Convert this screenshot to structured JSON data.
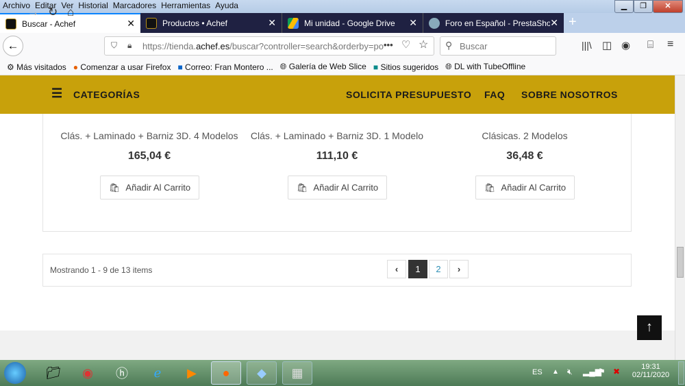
{
  "menu": [
    "Archivo",
    "Editar",
    "Ver",
    "Historial",
    "Marcadores",
    "Herramientas",
    "Ayuda"
  ],
  "tabs": [
    {
      "label": "Buscar - Achef"
    },
    {
      "label": "Productos • Achef"
    },
    {
      "label": "Mi unidad - Google Drive"
    },
    {
      "label": "Foro en Español - PrestaShop F"
    }
  ],
  "url": {
    "pre": "https://tienda.",
    "host": "achef.es",
    "post": "/buscar?controller=search&orderby=po"
  },
  "search_placeholder": "Buscar",
  "bookmarks": [
    "Más visitados",
    "Comenzar a usar Firefox",
    "Correo: Fran Montero ...",
    "Galería de Web Slice",
    "Sitios sugeridos",
    "DL with TubeOffline"
  ],
  "header": {
    "categories": "CATEGORÍAS",
    "nav": [
      "SOLICITA PRESUPUESTO",
      "FAQ",
      "SOBRE NOSOTROS"
    ]
  },
  "products": [
    {
      "name": "Clás. + Laminado + Barniz 3D. 4 Modelos",
      "price": "165,04 €",
      "cart": "Añadir Al Carrito"
    },
    {
      "name": "Clás. + Laminado + Barniz 3D. 1 Modelo",
      "price": "111,10 €",
      "cart": "Añadir Al Carrito"
    },
    {
      "name": "Clásicas. 2 Modelos",
      "price": "36,48 €",
      "cart": "Añadir Al Carrito"
    }
  ],
  "pagination": {
    "summary": "Mostrando 1 - 9 de 13 items",
    "pages": [
      "1",
      "2"
    ],
    "current": "1"
  },
  "tray": {
    "lang": "ES",
    "time": "19:31",
    "date": "02/11/2020"
  }
}
